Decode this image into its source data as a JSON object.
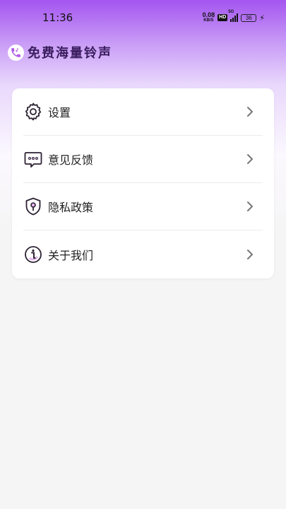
{
  "status_bar": {
    "time": "11:36",
    "net_speed_value": "0.08",
    "net_speed_unit": "KB/S",
    "hd_badge": "HD",
    "network_type": "5G",
    "battery_level": "36"
  },
  "app": {
    "title": "免费海量铃声"
  },
  "menu": {
    "items": [
      {
        "label": "设置",
        "icon": "gear-icon"
      },
      {
        "label": "意见反馈",
        "icon": "chat-bubble-icon"
      },
      {
        "label": "隐私政策",
        "icon": "shield-icon"
      },
      {
        "label": "关于我们",
        "icon": "info-icon"
      }
    ]
  },
  "colors": {
    "accent_purple": "#a455f0",
    "icon_stroke": "#2c2233",
    "icon_fill_accent": "#e5b8f0",
    "background": "#f5f5f5"
  }
}
